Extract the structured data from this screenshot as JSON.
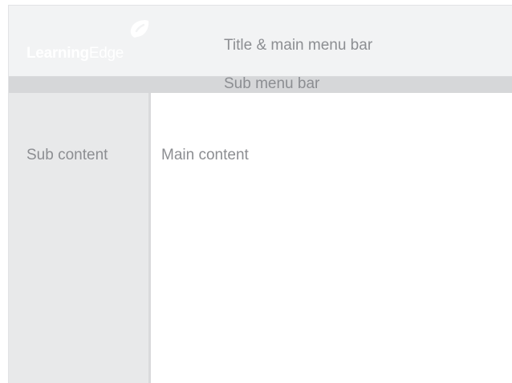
{
  "header": {
    "logo": {
      "strong_text": "Learning",
      "light_text": "Edge",
      "mark_icon": "leaf-bubble-icon"
    },
    "title_label": "Title & main menu bar"
  },
  "submenu": {
    "label": "Sub menu bar"
  },
  "sidebar": {
    "label": "Sub content"
  },
  "main": {
    "label": "Main content"
  },
  "colors": {
    "title_bar_bg": "#f2f3f4",
    "submenu_bg": "#d6d7d9",
    "sidebar_bg": "#e8e9ea",
    "label_text": "#8c8e92",
    "logo_text": "#ffffff"
  }
}
